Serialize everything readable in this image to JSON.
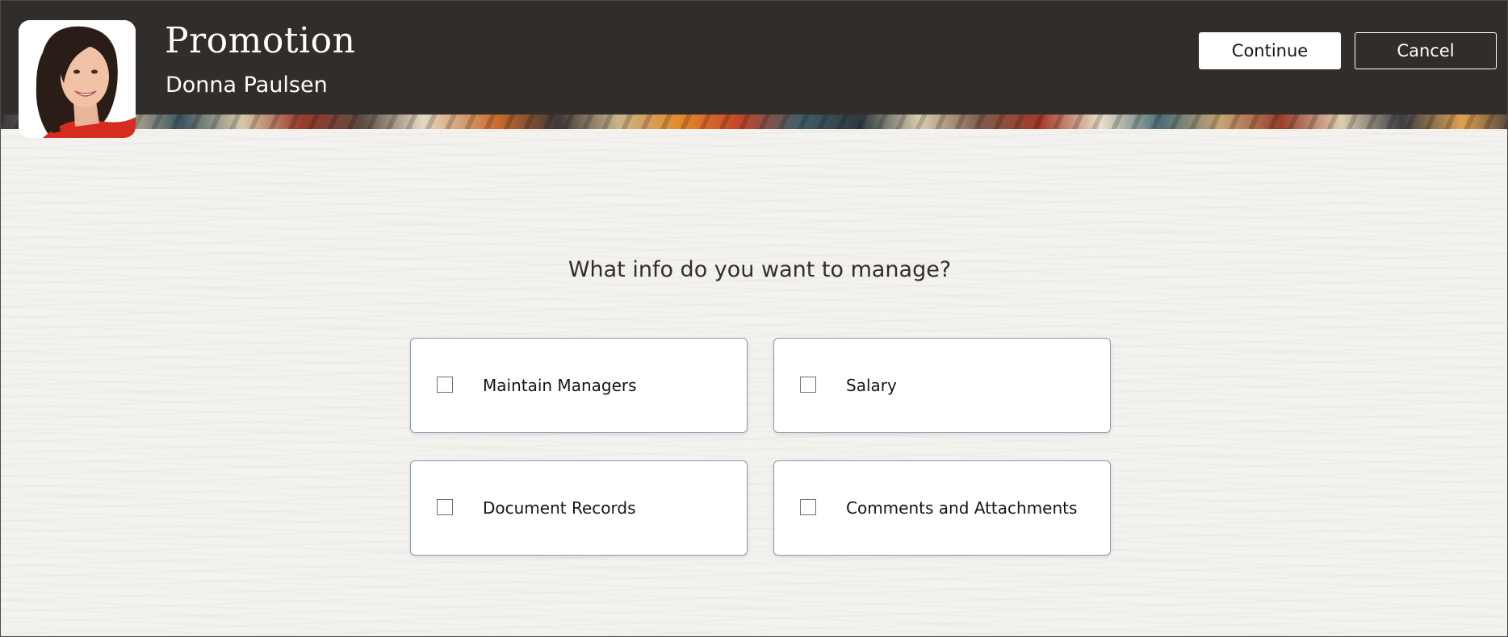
{
  "header": {
    "title": "Promotion",
    "person_name": "Donna Paulsen",
    "continue_label": "Continue",
    "cancel_label": "Cancel",
    "avatar_icon": "person-photo"
  },
  "main": {
    "question": "What info do you want to manage?",
    "options": [
      {
        "label": "Maintain Managers",
        "checked": false
      },
      {
        "label": "Salary",
        "checked": false
      },
      {
        "label": "Document Records",
        "checked": false
      },
      {
        "label": "Comments and Attachments",
        "checked": false
      }
    ]
  },
  "colors": {
    "header_bg": "#312d2a",
    "page_bg": "#f4f2ef",
    "card_border": "#8b9db0"
  }
}
